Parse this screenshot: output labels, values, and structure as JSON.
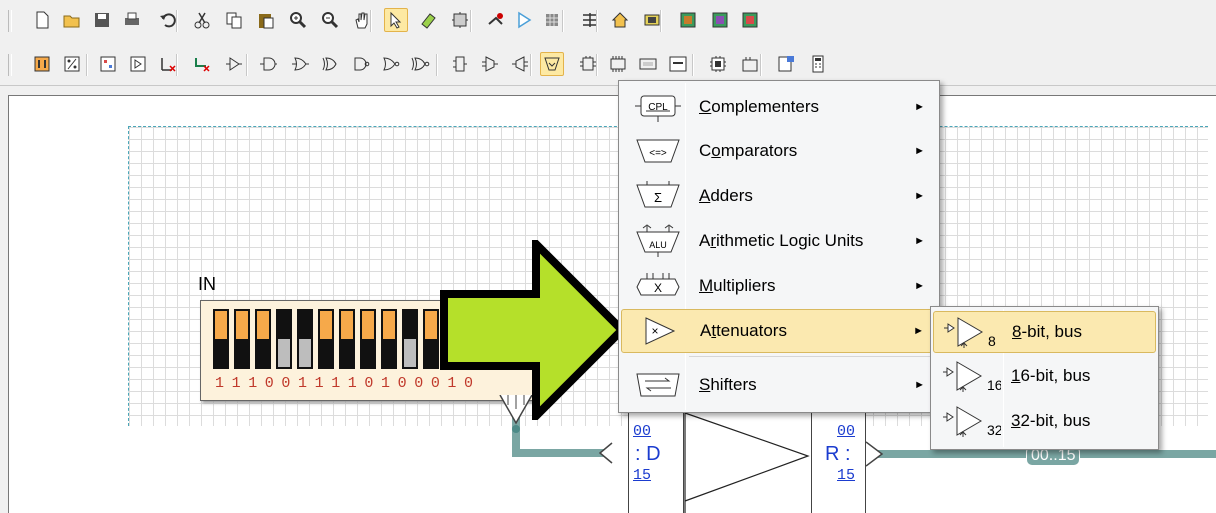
{
  "toolbar1": {
    "icons": [
      "new-file-icon",
      "open-folder-icon",
      "save-icon",
      "print-icon",
      "undo-icon",
      "cut-icon",
      "copy-icon",
      "paste-icon",
      "zoom-in-icon",
      "zoom-out-icon",
      "pan-hand-icon",
      "select-arrow-icon",
      "eraser-icon",
      "component-wizard-icon",
      "wire-tool-icon",
      "run-simulation-icon",
      "step-simulation-icon",
      "align-icon",
      "home-icon",
      "module-icon",
      "chip-icon",
      "chip-alt-icon",
      "chip-board-icon"
    ]
  },
  "toolbar2": {
    "icons": [
      "binary-switch-icon",
      "percent-icon",
      "grid-icon",
      "display-icon",
      "ground-icon",
      "disconnect-icon",
      "buffer-gate-icon",
      "and-gate-icon",
      "or-gate-icon",
      "xor-gate-icon",
      "nand-gate-icon",
      "nor-gate-icon",
      "xnor-gate-icon",
      "decoder-icon",
      "mux-icon",
      "demux-icon",
      "arithmetic-icon",
      "flipflop-icon",
      "counter-icon",
      "register-icon",
      "memory-icon",
      "cpu-icon",
      "terminal-icon",
      "settings-icon",
      "calculator-icon"
    ]
  },
  "circuit": {
    "dip_label": "IN",
    "dip_bits": "1110011110100010",
    "switch_states": [
      1,
      1,
      1,
      0,
      0,
      1,
      1,
      1,
      1,
      0,
      1,
      0,
      0,
      0,
      1,
      0
    ],
    "port_in_top": "00",
    "port_in_name": ": D",
    "port_in_bot": "15",
    "port_out_top": "00",
    "port_out_name": "R :",
    "port_out_bot": "15",
    "bus_label": "00..15"
  },
  "menu": {
    "items": [
      {
        "pre": "",
        "ul": "C",
        "post": "omplementers",
        "icon": "complementer-icon"
      },
      {
        "pre": "C",
        "ul": "o",
        "post": "mparators",
        "icon": "comparator-icon"
      },
      {
        "pre": "",
        "ul": "A",
        "post": "dders",
        "icon": "adder-icon"
      },
      {
        "pre": "A",
        "ul": "r",
        "post": "ithmetic Logic Units",
        "icon": "alu-icon"
      },
      {
        "pre": "",
        "ul": "M",
        "post": "ultipliers",
        "icon": "multiplier-icon"
      },
      {
        "pre": "A",
        "ul": "t",
        "post": "tenuators",
        "icon": "attenuator-icon"
      },
      {
        "pre": "",
        "ul": "S",
        "post": "hifters",
        "icon": "shifter-icon"
      }
    ],
    "icon_texts": {
      "cpl": "CPL",
      "cmp": "<=>",
      "sum": "Σ",
      "alu": "ALU",
      "mul": "X",
      "att": "×"
    },
    "submenu": [
      {
        "ul": "8",
        "post": "-bit, bus",
        "num": "8"
      },
      {
        "ul": "1",
        "post": "6-bit, bus",
        "num": "16"
      },
      {
        "ul": "3",
        "post": "2-bit, bus",
        "num": "32"
      }
    ],
    "submenu_arrow": "►"
  },
  "colors": {
    "highlight": "#fbe9b0",
    "green_arrow": "#b5e02a",
    "bus": "#7aa6a3",
    "switch_on": "#f6a94a"
  }
}
